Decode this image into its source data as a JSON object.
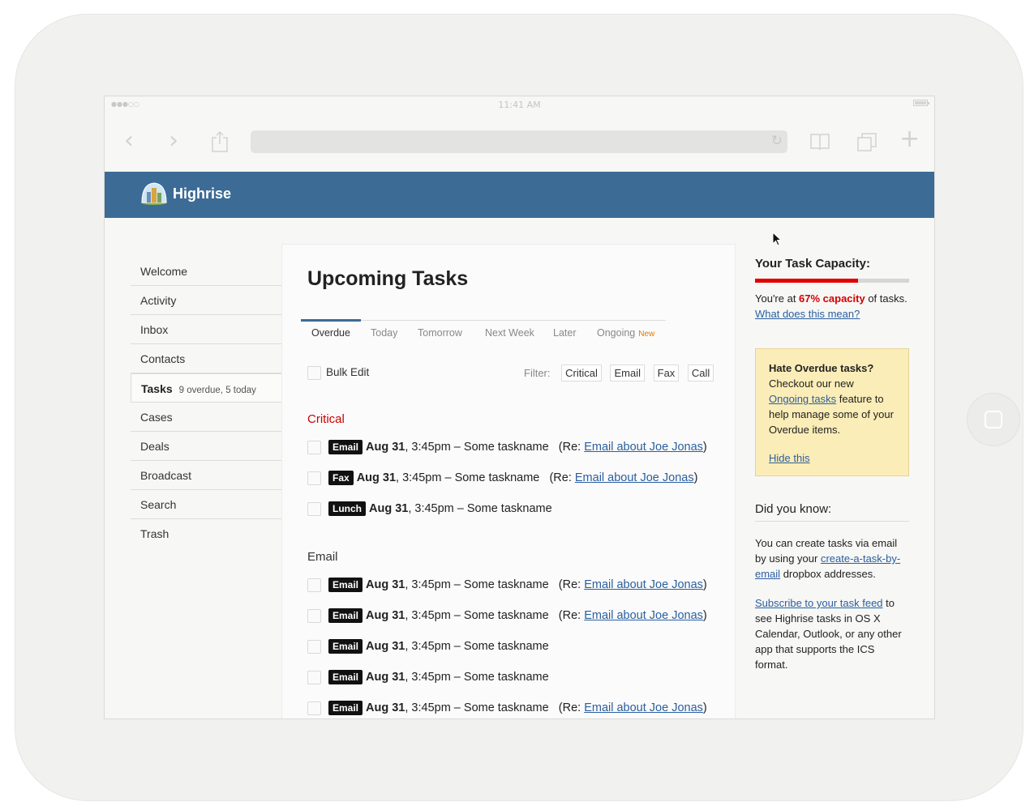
{
  "statusbar": {
    "time": "11:41 AM",
    "signal": "●●●○○"
  },
  "app": {
    "name": "Highrise"
  },
  "sidebar": {
    "items": [
      {
        "label": "Welcome",
        "meta": ""
      },
      {
        "label": "Activity",
        "meta": ""
      },
      {
        "label": "Inbox",
        "meta": ""
      },
      {
        "label": "Contacts",
        "meta": ""
      },
      {
        "label": "Tasks",
        "meta": "9 overdue, 5 today"
      },
      {
        "label": "Cases",
        "meta": ""
      },
      {
        "label": "Deals",
        "meta": ""
      },
      {
        "label": "Broadcast",
        "meta": ""
      },
      {
        "label": "Search",
        "meta": ""
      },
      {
        "label": "Trash",
        "meta": ""
      }
    ]
  },
  "main": {
    "title": "Upcoming Tasks",
    "tabs": [
      {
        "label": "Overdue"
      },
      {
        "label": "Today"
      },
      {
        "label": "Tomorrow"
      },
      {
        "label": "Next Week"
      },
      {
        "label": "Later"
      },
      {
        "label": "Ongoing",
        "badge": "New"
      }
    ],
    "bulk_edit": "Bulk Edit",
    "filter_label": "Filter:",
    "filters": [
      "Critical",
      "Email",
      "Fax",
      "Call"
    ],
    "sections": [
      {
        "title": "Critical",
        "tasks": [
          {
            "tag": "Email",
            "date": "Aug 31",
            "rest": ", 3:45pm – Some taskname",
            "re_prefix": "(Re: ",
            "link": "Email about Joe Jonas",
            "re_suffix": ")"
          },
          {
            "tag": "Fax",
            "date": "Aug 31",
            "rest": ", 3:45pm – Some taskname",
            "re_prefix": "(Re: ",
            "link": "Email about Joe Jonas",
            "re_suffix": ")"
          },
          {
            "tag": "Lunch",
            "date": "Aug 31",
            "rest": ", 3:45pm – Some taskname",
            "re_prefix": "",
            "link": "",
            "re_suffix": ""
          }
        ]
      },
      {
        "title": "Email",
        "tasks": [
          {
            "tag": "Email",
            "date": "Aug 31",
            "rest": ", 3:45pm – Some taskname",
            "re_prefix": "(Re: ",
            "link": "Email about Joe Jonas",
            "re_suffix": ")"
          },
          {
            "tag": "Email",
            "date": "Aug 31",
            "rest": ", 3:45pm – Some taskname",
            "re_prefix": "(Re: ",
            "link": "Email about Joe Jonas",
            "re_suffix": ")"
          },
          {
            "tag": "Email",
            "date": "Aug 31",
            "rest": ", 3:45pm – Some taskname",
            "re_prefix": "",
            "link": "",
            "re_suffix": ""
          },
          {
            "tag": "Email",
            "date": "Aug 31",
            "rest": ", 3:45pm – Some taskname",
            "re_prefix": "",
            "link": "",
            "re_suffix": ""
          },
          {
            "tag": "Email",
            "date": "Aug 31",
            "rest": ", 3:45pm – Some taskname",
            "re_prefix": "(Re: ",
            "link": "Email about Joe Jonas",
            "re_suffix": ")"
          }
        ]
      }
    ]
  },
  "right": {
    "capacity": {
      "title": "Your Task Capacity:",
      "percent": 67,
      "pre": "You're at ",
      "pct_text": "67% capacity",
      "post": " of tasks. ",
      "link": "What does this mean?"
    },
    "tip": {
      "title": "Hate Overdue tasks?",
      "line1": "Checkout our new ",
      "link": "Ongoing tasks",
      "line2": " feature to help manage some of your Overdue items.",
      "hide": "Hide this"
    },
    "dyk": {
      "title": "Did you know:",
      "p1_pre": "You can create tasks via email by using your ",
      "p1_link": "create-a-task-by-email",
      "p1_post": " dropbox addresses.",
      "p2_link": "Subscribe to your task feed",
      "p2_post": " to see Highrise tasks in OS X Calendar, Outlook, or any other app that supports the ICS format."
    }
  },
  "colors": {
    "header": "#3c6b96",
    "capacity_fill": "#e00000",
    "critical": "#cc0000",
    "tip_bg": "#fbedb7",
    "link": "#2a5f9e"
  }
}
